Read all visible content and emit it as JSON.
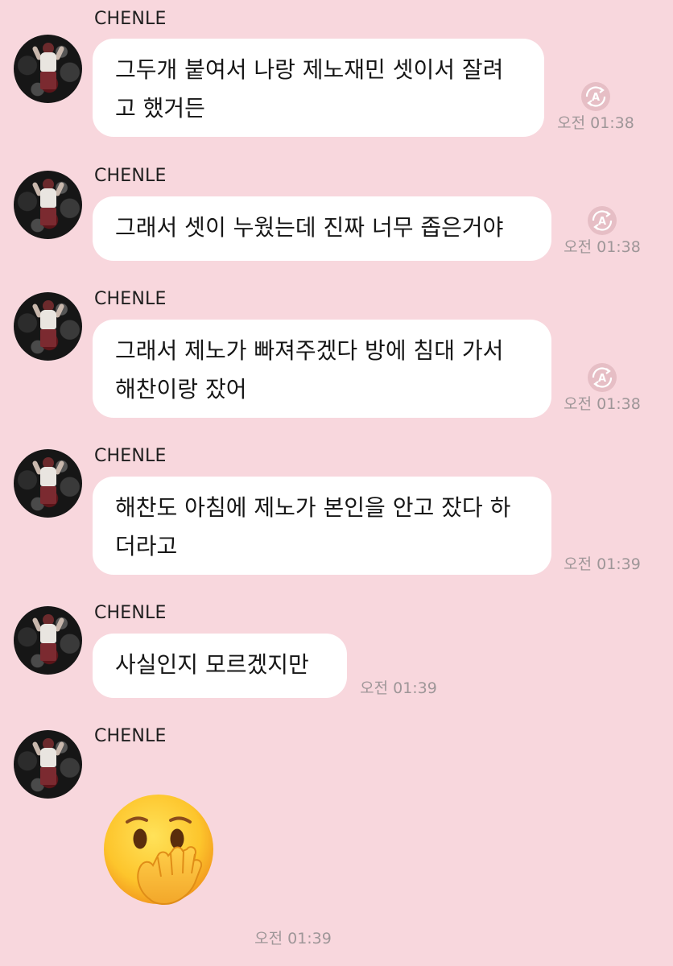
{
  "sender_name": "CHENLE",
  "messages": [
    {
      "sender": "CHENLE",
      "text": "그두개 붙여서 나랑 제노재민 셋이서 잘려\n고 했거든",
      "time": "오전 01:38",
      "translate_icon": "translate-icon"
    },
    {
      "sender": "CHENLE",
      "text": "그래서 셋이 누웠는데 진짜 너무 좁은거야",
      "time": "오전 01:38",
      "translate_icon": "translate-icon"
    },
    {
      "sender": "CHENLE",
      "text": "그래서 제노가 빠져주겠다 방에 침대 가서\n해찬이랑 잤어",
      "time": "오전 01:38",
      "translate_icon": "translate-icon"
    },
    {
      "sender": "CHENLE",
      "text": "해찬도 아침에 제노가 본인을 안고 잤다 하\n더라고",
      "time": "오전 01:39"
    },
    {
      "sender": "CHENLE",
      "text": "사실인지 모르겠지만",
      "time": "오전 01:39"
    },
    {
      "sender": "CHENLE",
      "emoji": "face-with-hand-over-mouth",
      "time": "오전 01:39"
    }
  ],
  "colors": {
    "background": "#f8d7dd",
    "bubble": "#ffffff",
    "time": "#9e9698"
  }
}
